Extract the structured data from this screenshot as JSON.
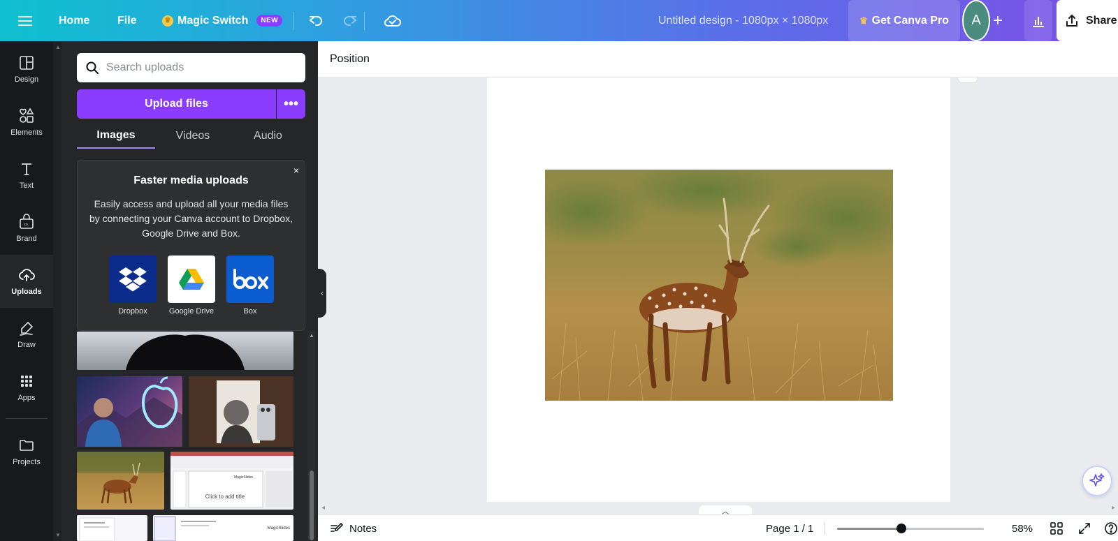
{
  "topbar": {
    "home": "Home",
    "file": "File",
    "magic_switch": "Magic Switch",
    "new_badge": "NEW",
    "design_title": "Untitled design - 1080px × 1080px",
    "get_pro": "Get Canva Pro",
    "avatar_initial": "A",
    "share": "Share"
  },
  "rail": {
    "items": [
      {
        "label": "Design"
      },
      {
        "label": "Elements"
      },
      {
        "label": "Text"
      },
      {
        "label": "Brand"
      },
      {
        "label": "Uploads"
      },
      {
        "label": "Draw"
      },
      {
        "label": "Apps"
      },
      {
        "label": "Projects"
      }
    ],
    "active": "Uploads"
  },
  "panel": {
    "search_placeholder": "Search uploads",
    "upload_button": "Upload files",
    "more_button": "•••",
    "tabs": [
      {
        "label": "Images"
      },
      {
        "label": "Videos"
      },
      {
        "label": "Audio"
      }
    ],
    "active_tab": "Images",
    "promo": {
      "title": "Faster media uploads",
      "text": "Easily access and upload all your media files by connecting your Canva account to Dropbox, Google Drive and Box.",
      "close": "×",
      "services": [
        {
          "label": "Dropbox"
        },
        {
          "label": "Google Drive"
        },
        {
          "label": "Box"
        }
      ]
    },
    "thumb_slide_title": "Click to add title"
  },
  "workspace": {
    "context_label": "Position"
  },
  "footer": {
    "notes": "Notes",
    "page_indicator": "Page 1 / 1",
    "zoom": "58%",
    "zoom_slider_fraction": 0.44
  },
  "colors": {
    "accent": "#8b3dff",
    "rail_bg": "#18191b",
    "panel_bg": "#252627"
  }
}
